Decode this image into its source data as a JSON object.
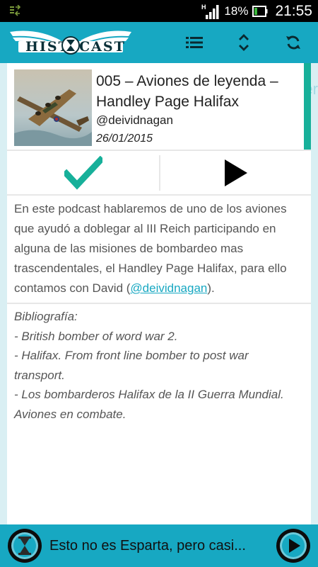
{
  "status_bar": {
    "battery_percent": "18%",
    "time": "21:55",
    "network_type": "H",
    "icons": [
      "data-transfer-icon",
      "signal-icon",
      "battery-icon"
    ]
  },
  "app_bar": {
    "logo_text": "HISTOCAST",
    "logo_left": "HIST",
    "logo_right": "CAST",
    "actions": [
      "list-icon",
      "expand-collapse-icon",
      "refresh-icon"
    ]
  },
  "side_peek": {
    "text": "er"
  },
  "episode": {
    "title": "005 – Aviones de leyenda – Handley Page Halifax",
    "author": "@deividnagan",
    "date": "26/01/2015",
    "image_icon": "bomber-plane-thumbnail",
    "played": true,
    "actions": [
      "checkmark-icon",
      "play-icon"
    ]
  },
  "description": {
    "text_before": "En este podcast hablaremos de uno de los aviones que ayudó a doblegar al III Reich participando en alguna de las misiones de bombardeo mas trascendentales, el Handley Page Halifax, para ello contamos con David (",
    "link_text": "@deividnagan",
    "text_after": ")."
  },
  "bibliography": {
    "heading": "Bibliografía:",
    "items": [
      "- British bomber of word war 2.",
      "- Halifax. From front line bomber to post war transport.",
      "- Los bombarderos Halifax de la II Guerra Mundial. Aviones en combate."
    ]
  },
  "player": {
    "now_playing": "Esto no es Esparta, pero casi...",
    "icons": [
      "hourglass-avatar-icon",
      "play-circle-icon"
    ]
  },
  "colors": {
    "accent": "#17a8c2",
    "check_green": "#17b09a",
    "background": "#d9eff3"
  }
}
